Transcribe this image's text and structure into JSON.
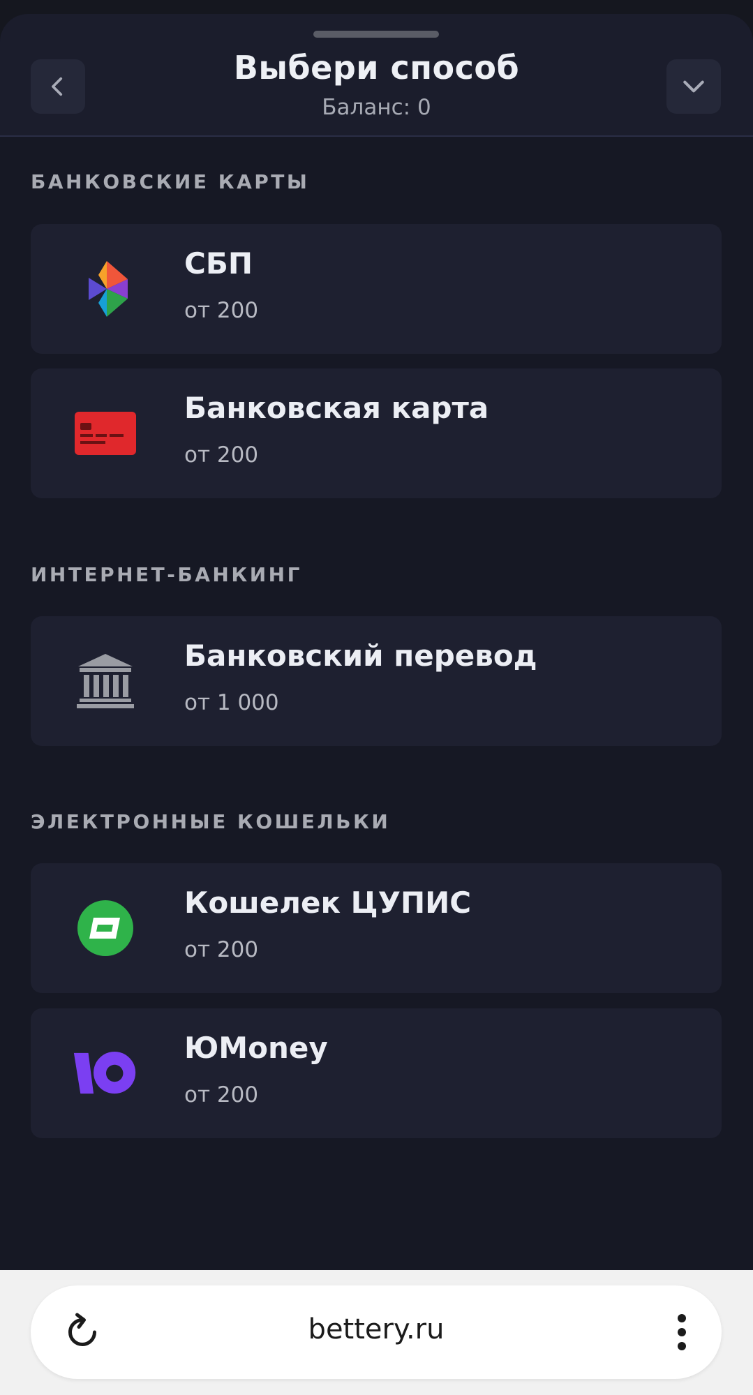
{
  "header": {
    "title": "Выбери способ",
    "balance": "Баланс: 0",
    "back_icon": "chevron-left-icon",
    "collapse_icon": "chevron-down-icon"
  },
  "sections": [
    {
      "title": "БАНКОВСКИЕ КАРТЫ",
      "items": [
        {
          "name": "СБП",
          "min": "от 200",
          "icon": "sbp-logo-icon"
        },
        {
          "name": "Банковская карта",
          "min": "от 200",
          "icon": "bank-card-icon",
          "icon_color": "#e0282c"
        }
      ]
    },
    {
      "title": "ИНТЕРНЕТ-БАНКИНГ",
      "items": [
        {
          "name": "Банковский перевод",
          "min": "от 1 000",
          "icon": "bank-building-icon",
          "icon_color": "#9a9ca3"
        }
      ]
    },
    {
      "title": "ЭЛЕКТРОННЫЕ КОШЕЛЬКИ",
      "items": [
        {
          "name": "Кошелек ЦУПИС",
          "min": "от 200",
          "icon": "cupis-wallet-icon",
          "icon_color": "#2fb34a"
        },
        {
          "name": "ЮMoney",
          "min": "от 200",
          "icon": "yoomoney-logo-icon",
          "icon_color": "#7b3ff2"
        }
      ]
    }
  ],
  "browser": {
    "url": "bettery.ru",
    "reload_icon": "reload-icon",
    "menu_icon": "more-vertical-icon"
  },
  "colors": {
    "background": "#161824",
    "card": "#1e2030",
    "header": "#1b1d2c"
  }
}
